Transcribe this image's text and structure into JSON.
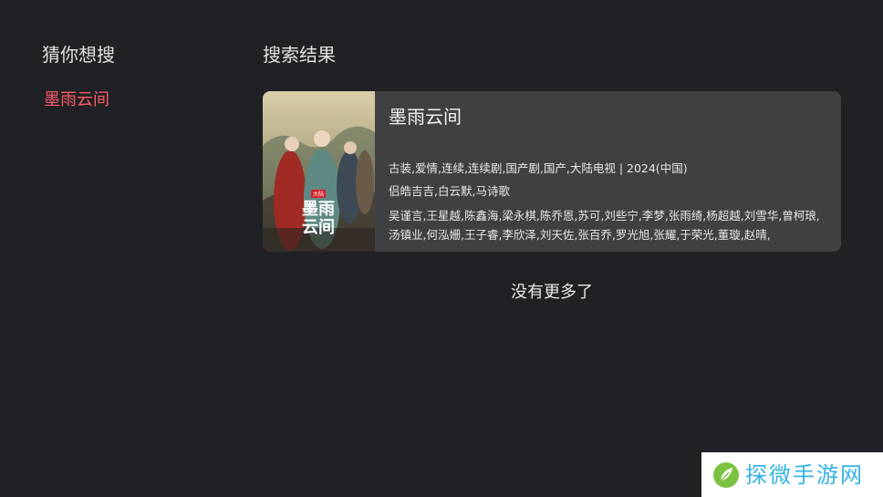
{
  "suggestions": {
    "title": "猜你想搜",
    "items": [
      "墨雨云间"
    ]
  },
  "results": {
    "title": "搜索结果",
    "items": [
      {
        "title": "墨雨云间",
        "genres": "古装,爱情,连续,连续剧,国产剧,国产,大陆电视 | 2024(中国)",
        "directors": "侣皓吉吉,白云默,马诗歌",
        "cast": "吴谨言,王星越,陈鑫海,梁永棋,陈乔恩,苏可,刘些宁,李梦,张雨绮,杨超越,刘雪华,曾柯琅,汤镇业,何泓姗,王子睿,李欣泽,刘天佐,张百乔,罗光旭,张耀,于荣光,董璇,赵晴,",
        "poster": {
          "badge": "大陆",
          "title_line1": "墨雨",
          "title_line2": "云间"
        }
      }
    ]
  },
  "footer": {
    "no_more": "没有更多了"
  },
  "watermark": {
    "text": "探微手游网"
  },
  "colors": {
    "background": "#1f2124",
    "card": "#3e4042",
    "accent": "#ff5a6a",
    "watermark_text": "#34b3e6"
  }
}
